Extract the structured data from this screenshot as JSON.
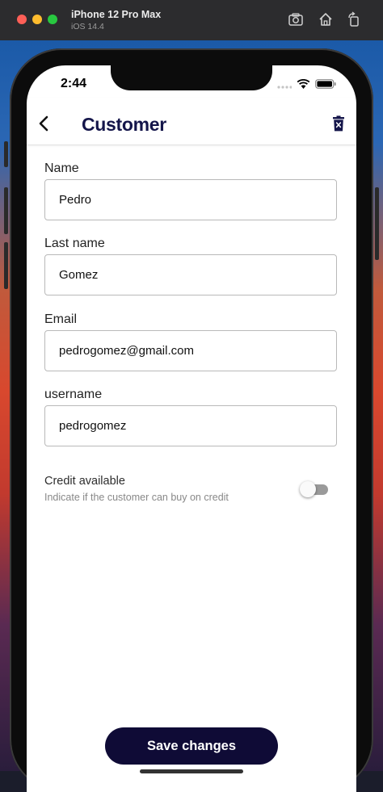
{
  "simulator": {
    "device": "iPhone 12 Pro Max",
    "os": "iOS 14.4",
    "toolbar_icons": [
      "screenshot-icon",
      "home-icon",
      "rotate-icon"
    ]
  },
  "status_bar": {
    "time": "2:44"
  },
  "header": {
    "title": "Customer",
    "back_icon": "chevron-left-icon",
    "delete_icon": "trash-icon"
  },
  "form": {
    "fields": [
      {
        "label": "Name",
        "value": "Pedro"
      },
      {
        "label": "Last name",
        "value": "Gomez"
      },
      {
        "label": "Email",
        "value": "pedrogomez@gmail.com"
      },
      {
        "label": "username",
        "value": "pedrogomez"
      }
    ],
    "credit": {
      "title": "Credit available",
      "description": "Indicate if the customer can buy on credit",
      "enabled": false
    }
  },
  "actions": {
    "save_label": "Save changes"
  },
  "colors": {
    "accent": "#14154a",
    "button": "#0f0b36"
  }
}
